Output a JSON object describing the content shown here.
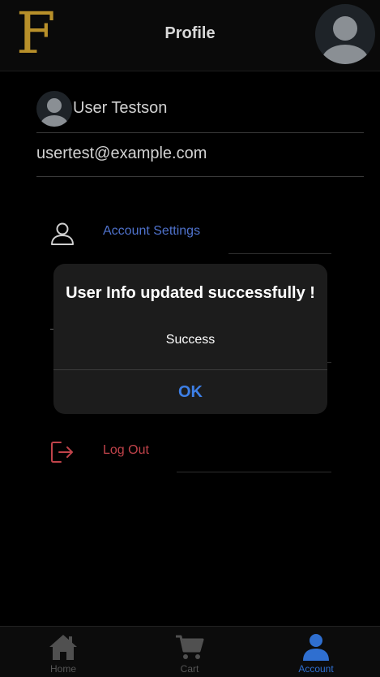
{
  "header": {
    "logo_text": "F",
    "title": "Profile",
    "avatar_icon": "user-avatar-icon"
  },
  "profile": {
    "name": "User Testson",
    "email": "usertest@example.com"
  },
  "menu": {
    "account_settings_label": "Account Settings",
    "account_settings_icon": "user-outline-icon",
    "logout_label": "Log Out",
    "logout_icon": "logout-icon"
  },
  "dialog": {
    "title": "User Info updated successfully !",
    "message": "Success",
    "ok_label": "OK"
  },
  "tabbar": {
    "tabs": [
      {
        "label": "Home",
        "icon": "home-icon",
        "active": false
      },
      {
        "label": "Cart",
        "icon": "cart-icon",
        "active": false
      },
      {
        "label": "Account",
        "icon": "person-icon",
        "active": true
      }
    ]
  },
  "colors": {
    "accent_blue": "#3d7fe6",
    "logout_red": "#c0434a",
    "logo_gold": "#b8902a"
  }
}
